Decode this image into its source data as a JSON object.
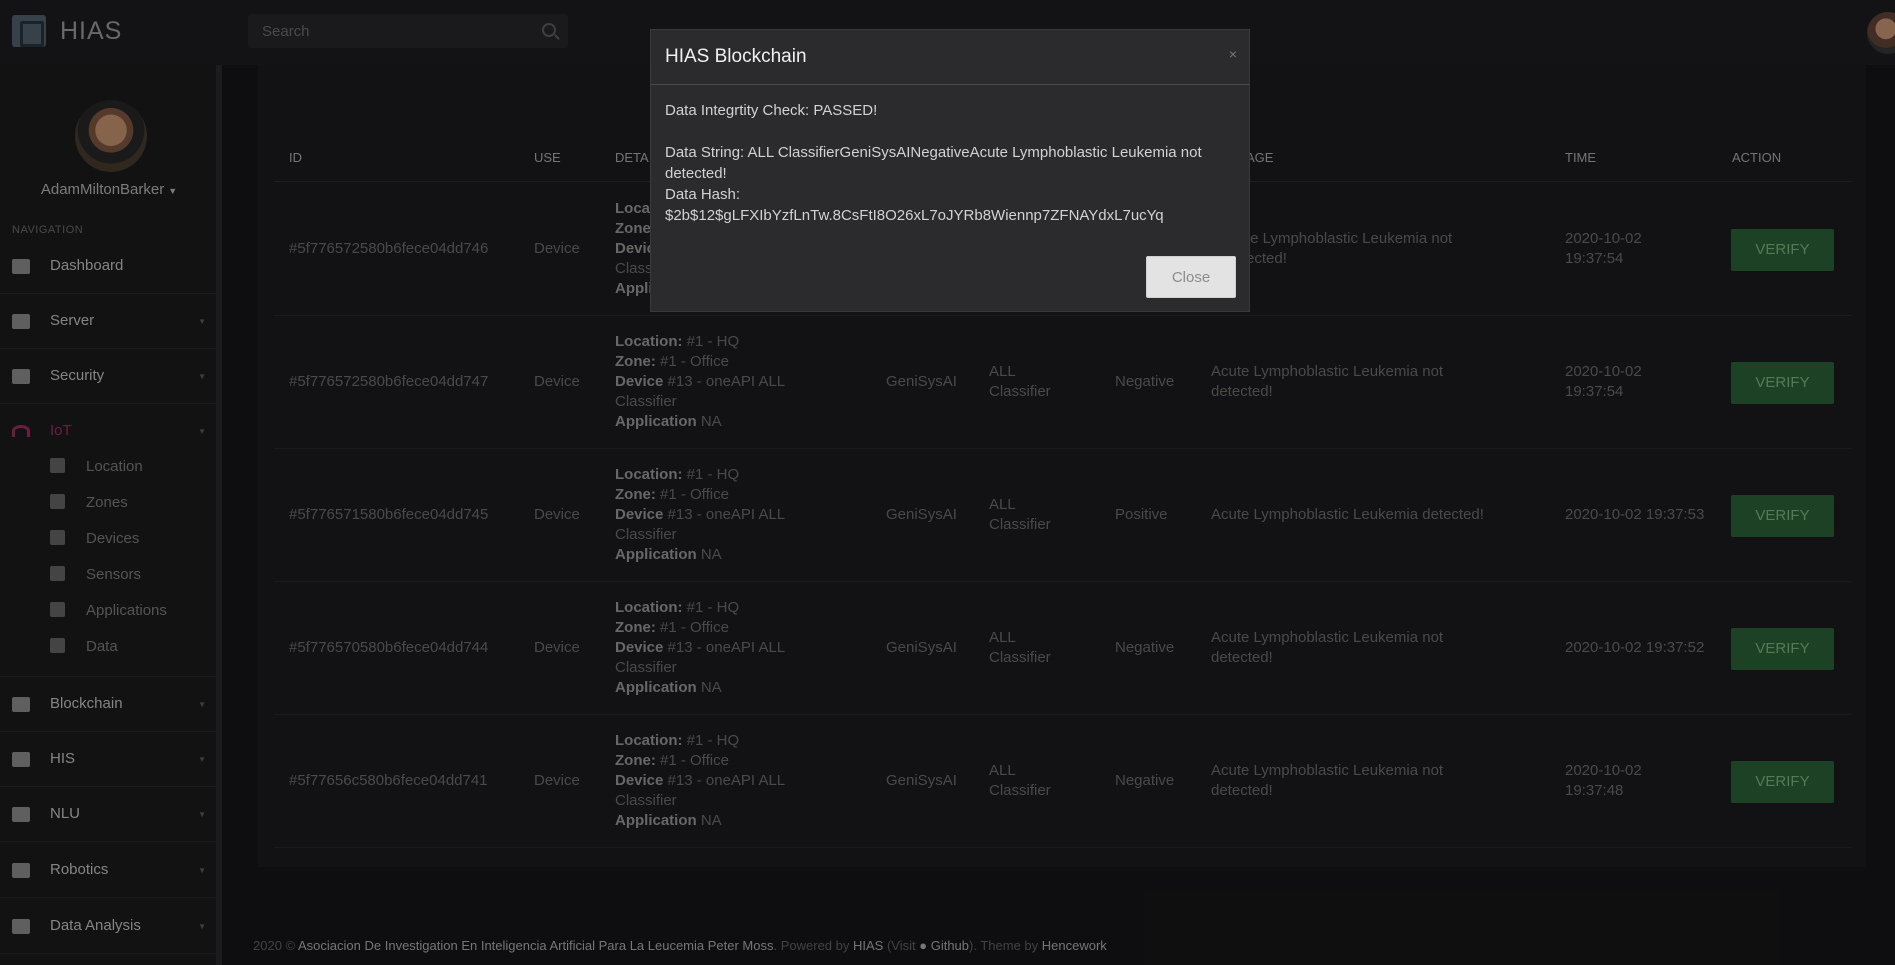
{
  "app": {
    "name": "HIAS"
  },
  "search": {
    "placeholder": "Search"
  },
  "sidebar": {
    "user": "AdamMiltonBarker",
    "heading": "NAVIGATION",
    "items": [
      {
        "label": "Dashboard",
        "icon": "dashboard-icon"
      },
      {
        "label": "Server",
        "icon": "server-icon"
      },
      {
        "label": "Security",
        "icon": "security-icon"
      },
      {
        "label": "IoT",
        "icon": "wifi-icon"
      },
      {
        "label": "Blockchain",
        "icon": "bitcoin-icon"
      },
      {
        "label": "HIS",
        "icon": "hospital-icon"
      },
      {
        "label": "NLU",
        "icon": "chat-icon"
      },
      {
        "label": "Robotics",
        "icon": "robot-icon"
      },
      {
        "label": "Data Analysis",
        "icon": "table-icon"
      }
    ],
    "iot_sub": [
      {
        "label": "Location",
        "icon": "map-pin-icon"
      },
      {
        "label": "Zones",
        "icon": "sitemap-icon"
      },
      {
        "label": "Devices",
        "icon": "wifi-icon"
      },
      {
        "label": "Sensors",
        "icon": "upload-icon"
      },
      {
        "label": "Applications",
        "icon": "mobile-icon"
      },
      {
        "label": "Data",
        "icon": "area-chart-icon"
      }
    ]
  },
  "table": {
    "headers": {
      "id": "ID",
      "use": "USE",
      "details": "DETA",
      "message": "AGE",
      "time": "TIME",
      "action": "ACTION"
    },
    "verify_label": "VERIFY",
    "rows": [
      {
        "id": "5f776572580b6fece04dd746",
        "use": "Device",
        "partial": [
          "Loca",
          "Zone",
          "Devic",
          "Classi",
          "Applic"
        ],
        "message": "te Lymphoblastic Leukemia not",
        "message2": "ected!",
        "time": "2020-10-02",
        "time2": "19:37:54"
      },
      {
        "id": "5f776572580b6fece04dd747",
        "use": "Device",
        "loc_label": "Location:",
        "loc": " #1 - HQ",
        "zone_label": "Zone:",
        "zone": " #1 - Office",
        "dev_label": "Device",
        "dev": " #13 - oneAPI ALL",
        "dev2": "Classifier",
        "app_label": "Application",
        "app": " NA",
        "ai": "GeniSysAI",
        "cls": "ALL",
        "cls2": "Classifier",
        "result": "Negative",
        "message": "Acute Lymphoblastic Leukemia not",
        "message2": "detected!",
        "time": "2020-10-02",
        "time2": "19:37:54"
      },
      {
        "id": "5f776571580b6fece04dd745",
        "use": "Device",
        "loc_label": "Location:",
        "loc": " #1 - HQ",
        "zone_label": "Zone:",
        "zone": " #1 - Office",
        "dev_label": "Device",
        "dev": " #13 - oneAPI ALL",
        "dev2": "Classifier",
        "app_label": "Application",
        "app": " NA",
        "ai": "GeniSysAI",
        "cls": "ALL",
        "cls2": "Classifier",
        "result": "Positive",
        "message": "Acute Lymphoblastic Leukemia detected!",
        "message2": "",
        "time": "2020-10-02 19:37:53",
        "time2": ""
      },
      {
        "id": "5f776570580b6fece04dd744",
        "use": "Device",
        "loc_label": "Location:",
        "loc": " #1 - HQ",
        "zone_label": "Zone:",
        "zone": " #1 - Office",
        "dev_label": "Device",
        "dev": " #13 - oneAPI ALL",
        "dev2": "Classifier",
        "app_label": "Application",
        "app": " NA",
        "ai": "GeniSysAI",
        "cls": "ALL",
        "cls2": "Classifier",
        "result": "Negative",
        "message": "Acute Lymphoblastic Leukemia not",
        "message2": "detected!",
        "time": "2020-10-02 19:37:52",
        "time2": ""
      },
      {
        "id": "5f77656c580b6fece04dd741",
        "use": "Device",
        "loc_label": "Location:",
        "loc": " #1 - HQ",
        "zone_label": "Zone:",
        "zone": " #1 - Office",
        "dev_label": "Device",
        "dev": " #13 - oneAPI ALL",
        "dev2": "Classifier",
        "app_label": "Application",
        "app": " NA",
        "ai": "GeniSysAI",
        "cls": "ALL",
        "cls2": "Classifier",
        "result": "Negative",
        "message": "Acute Lymphoblastic Leukemia not",
        "message2": "detected!",
        "time": "2020-10-02",
        "time2": "19:37:48"
      }
    ]
  },
  "footer": {
    "prefix": "2020 © ",
    "org": "Asociacion De Investigation En Inteligencia Artificial Para La Leucemia Peter Moss",
    "powered": ". Powered by ",
    "hias": "HIAS",
    "visit": " (Visit ",
    "github": "Github",
    "theme": "). Theme by ",
    "hencework": "Hencework"
  },
  "modal": {
    "title": "HIAS Blockchain",
    "close_x": "×",
    "check": "Data Integrtity Check: PASSED!",
    "string_line1": "Data String: ALL ClassifierGeniSysAINegativeAcute Lymphoblastic Leukemia not",
    "string_line2": "detected!",
    "hash_label": "Data Hash:",
    "hash_value": "$2b$12$gLFXIbYzfLnTw.8CsFtI8O26xL7oJYRb8Wiennp7ZFNAYdxL7ucYq",
    "close_button": "Close"
  },
  "colors": {
    "accent": "#b0306b",
    "verify_bg": "#2f6a3a",
    "verify_text": "#86c490"
  }
}
